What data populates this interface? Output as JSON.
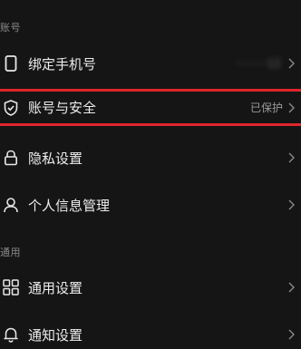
{
  "sections": [
    {
      "title": "账号",
      "items": [
        {
          "label": "绑定手机号",
          "value": "·········12",
          "icon": "phone-icon"
        },
        {
          "label": "账号与安全",
          "value": "已保护",
          "icon": "shield-icon"
        },
        {
          "label": "隐私设置",
          "value": "",
          "icon": "lock-icon"
        },
        {
          "label": "个人信息管理",
          "value": "",
          "icon": "person-icon"
        }
      ]
    },
    {
      "title": "通用",
      "items": [
        {
          "label": "通用设置",
          "value": "",
          "icon": "grid-icon"
        },
        {
          "label": "通知设置",
          "value": "",
          "icon": "bell-icon"
        }
      ]
    }
  ],
  "highlight_color": "#e0262a",
  "chevron_glyph": "chevron-right-icon"
}
